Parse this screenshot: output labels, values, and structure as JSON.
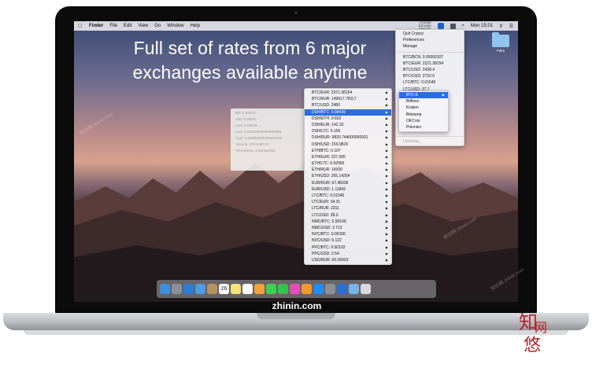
{
  "menubar": {
    "items": [
      "Finder",
      "File",
      "Edit",
      "View",
      "Go",
      "Window",
      "Help"
    ],
    "stats": [
      "LTC/USD",
      "BTC/USD",
      "ETH/USD"
    ],
    "clock": "Mon 15:01"
  },
  "headline": {
    "line1": "Full set of rates from 6 major",
    "line2": "exchanges available anytime"
  },
  "tooltip": [
    "Bill: 0.08423",
    "Ask: 0.08462",
    "Last: 0.08439",
    "Low: 0.08333999999999999",
    "High: 0.08880000000000000",
    "Volume: 3716.38746",
    "Timestamp: 1466462058"
  ],
  "rate_menu": [
    {
      "label": "BTC/EUR: 2221.38154",
      "selected": false
    },
    {
      "label": "BTC/RUR: 149617.78117",
      "selected": false
    },
    {
      "label": "BTC/USD: 2480",
      "selected": false
    },
    {
      "label": "DSH/BTC: 0.08439",
      "selected": true
    },
    {
      "label": "DSH/ETH: 0.602",
      "selected": false
    },
    {
      "label": "DSH/EUR: 142.32",
      "selected": false
    },
    {
      "label": "DSH/LTC: 4.155",
      "selected": false
    },
    {
      "label": "DSH/RUR: 9820.744000000001",
      "selected": false
    },
    {
      "label": "DSH/USD: 159.9815",
      "selected": false
    },
    {
      "label": "ETH/BTC: 0.107",
      "selected": false
    },
    {
      "label": "ETH/EUR: 237.306",
      "selected": false
    },
    {
      "label": "ETH/LTC: 6.92965",
      "selected": false
    },
    {
      "label": "ETH/RUR: 16000",
      "selected": false
    },
    {
      "label": "ETH/USD: 265.14254",
      "selected": false
    },
    {
      "label": "EUR/RUR: 67.48336",
      "selected": false
    },
    {
      "label": "EUR/USD: 1.11842",
      "selected": false
    },
    {
      "label": "LTC/BTC: 0.01546",
      "selected": false
    },
    {
      "label": "LTC/EUR: 34.31",
      "selected": false
    },
    {
      "label": "LTC/RUR: 2311",
      "selected": false
    },
    {
      "label": "LTC/USD: 38.3",
      "selected": false
    },
    {
      "label": "NMC/BTC: 0.00109",
      "selected": false
    },
    {
      "label": "NMC/USD: 2.712",
      "selected": false
    },
    {
      "label": "NVC/BTC: 0.00156",
      "selected": false
    },
    {
      "label": "NVC/USD: 9.122",
      "selected": false
    },
    {
      "label": "PPC/BTC: 0.00102",
      "selected": false
    },
    {
      "label": "PPC/USD: 2.54",
      "selected": false
    },
    {
      "label": "USD/RUR: 60.29923",
      "selected": false
    }
  ],
  "app_menu": {
    "top": [
      "Quit Crypzy",
      "Preferences",
      "Manage"
    ],
    "pairs": [
      "BTC/BCN: 0.00000107",
      "BTC/EUR: 2221.38154",
      "BTC/USD: 2438.4",
      "BTC/USD: 2732.0",
      "LTC/BTC: 0.01546",
      "LTC/USD: 37.7"
    ],
    "exchanges": [
      "BTC-E",
      "Bitfinex",
      "Kraken",
      "Bitstamp",
      "OKCoin",
      "Poloniex"
    ],
    "status": "Updating..."
  },
  "desktop": {
    "folder_label": "Files"
  },
  "dock_icons": [
    "finder-icon",
    "launchpad-icon",
    "safari-icon",
    "mail-icon",
    "contacts-icon",
    "calendar-icon",
    "notes-icon",
    "reminders-icon",
    "photos-icon",
    "messages-icon",
    "facetime-icon",
    "itunes-icon",
    "ibooks-icon",
    "appstore-icon",
    "preferences-icon",
    "crypzy-icon",
    "folder-icon",
    "trash-icon"
  ],
  "calendar_day": "26",
  "brand": "zhinin.com",
  "watermarks": [
    "知识网 zhinin.com",
    "知识网 zhinin.com",
    "知识网 zhinin.com"
  ],
  "colors": {
    "selection": "#2b6de1",
    "accent_logo": "#b3262a"
  }
}
